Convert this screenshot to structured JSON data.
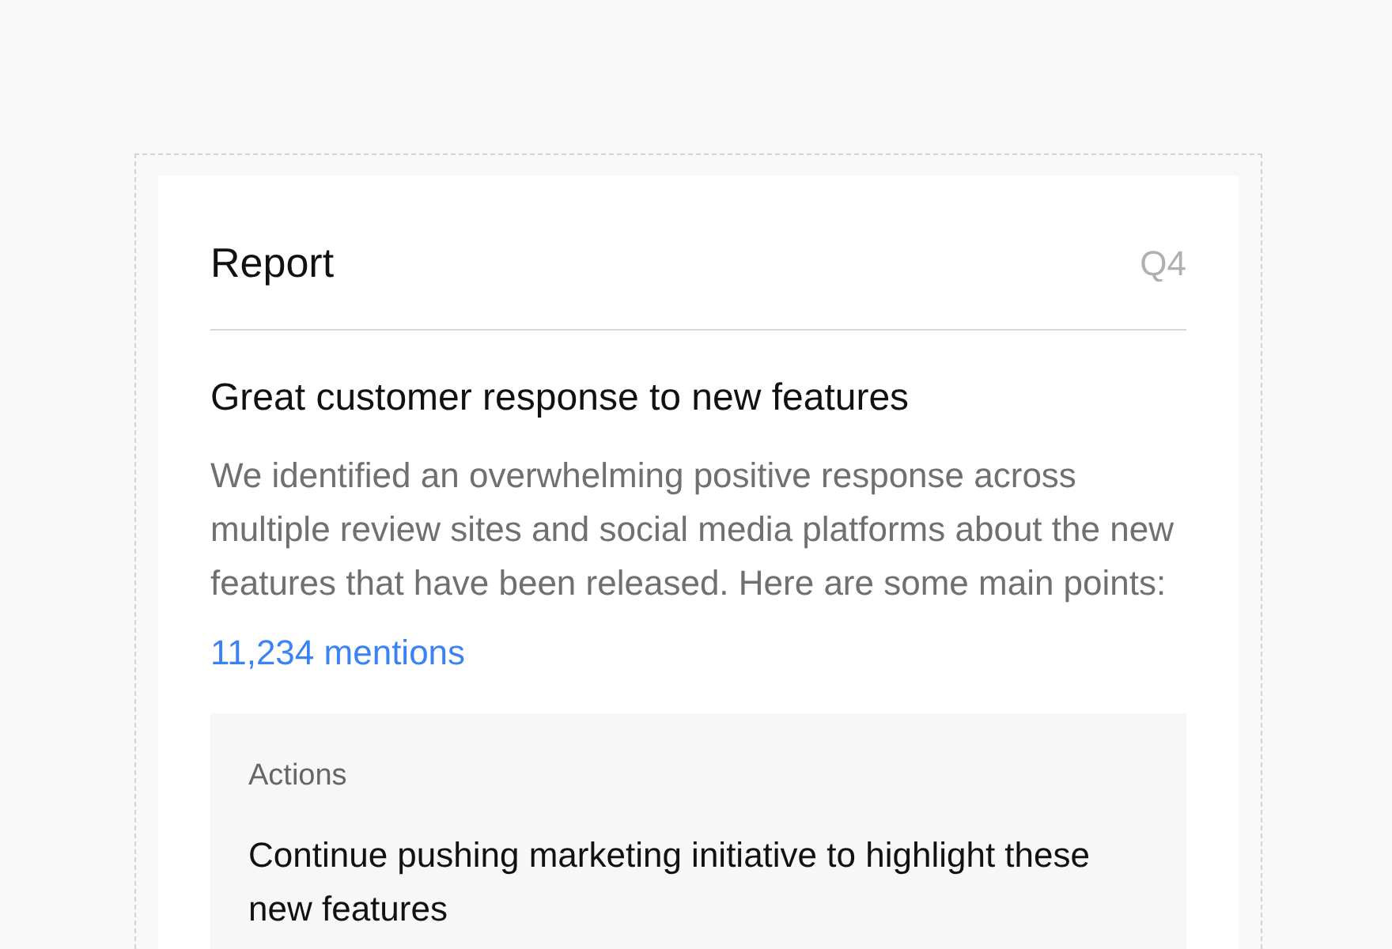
{
  "card": {
    "title": "Report",
    "period": "Q4",
    "headline": "Great customer response to new features",
    "description": "We identified an overwhelming positive response across multiple review sites and social media platforms about the new features that have been released. Here are some main points:",
    "mentions_link": "11,234 mentions",
    "actions": {
      "label": "Actions",
      "items": [
        "Continue pushing marketing initiative to highlight these new features"
      ]
    }
  }
}
